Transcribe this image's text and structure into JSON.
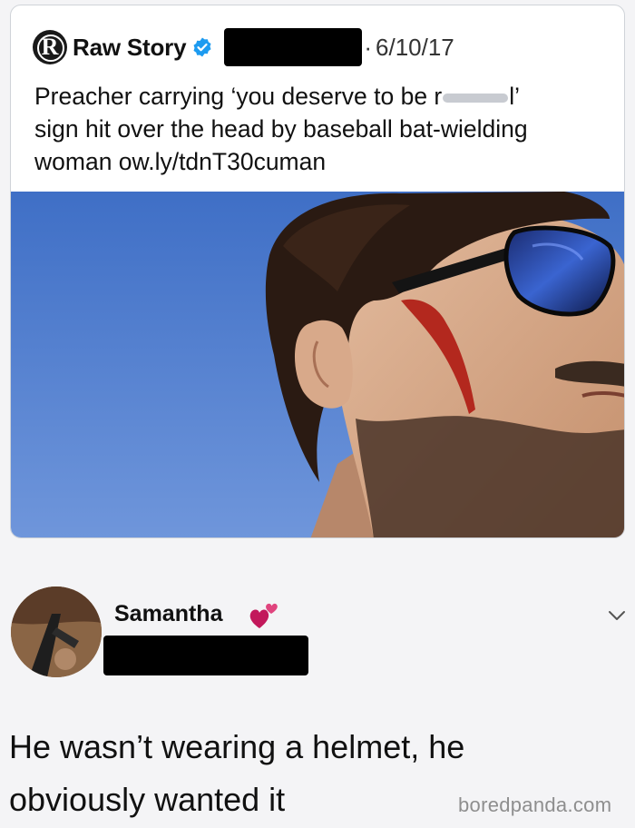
{
  "quoted_tweet": {
    "logo_letter": "R",
    "account_name": "Raw Story",
    "separator": "·",
    "date": "6/10/17",
    "text_lines": [
      {
        "before": "Preacher carrying ‘you deserve to be r",
        "after": "l’"
      },
      {
        "text": "sign hit over the head by baseball bat-wielding"
      },
      {
        "text": "woman ow.ly/tdnT30cuman"
      }
    ],
    "photo_icon": "man-with-sunglasses-photo"
  },
  "reply": {
    "name": "Samantha",
    "name_emoji": "two-hearts-icon",
    "text_lines": [
      "He wasn’t wearing a helmet, he",
      "obviously wanted it"
    ]
  },
  "watermark": "boredpanda.com",
  "colors": {
    "background": "#f4f4f6",
    "verified_blue": "#1d9bf0",
    "heart_pink": "#c2185b",
    "redaction": "#000000"
  }
}
